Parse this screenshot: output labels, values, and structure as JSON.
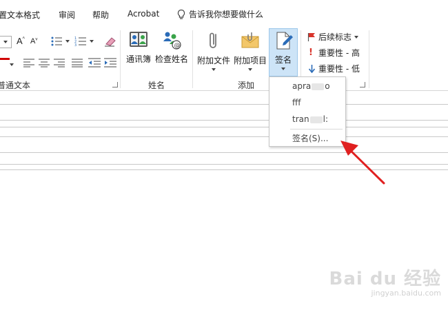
{
  "tabs": {
    "format_text": "置文本格式",
    "review": "审阅",
    "help": "帮助",
    "acrobat": "Acrobat",
    "tell_me": "告诉我你想要做什么"
  },
  "ribbon": {
    "basic_text_group": "普通文本",
    "names_group": "姓名",
    "add_group": "添加",
    "address_book": "通讯簿",
    "check_names": "检查姓名",
    "attach_file": "附加文件",
    "attach_item": "附加项目",
    "signature": "签名",
    "follow_up": "后续标志",
    "importance_high": "重要性 - 高",
    "importance_low": "重要性 - 低"
  },
  "signature_menu": {
    "items": [
      "apra░░o",
      "fff",
      "tran░░l:"
    ],
    "item_prefixes": [
      "apra",
      "fff",
      "tran"
    ],
    "item_suffixes": [
      "o",
      "",
      "l:"
    ],
    "signatures_command": "签名(S)..."
  },
  "watermark": {
    "main": "Bai du 经验",
    "sub": "jingyan.baidu.com"
  },
  "colors": {
    "accent_selected": "#cde4f7",
    "arrow": "#e02020",
    "flag_red": "#d9342b",
    "importance_low_blue": "#2b6cb8"
  }
}
